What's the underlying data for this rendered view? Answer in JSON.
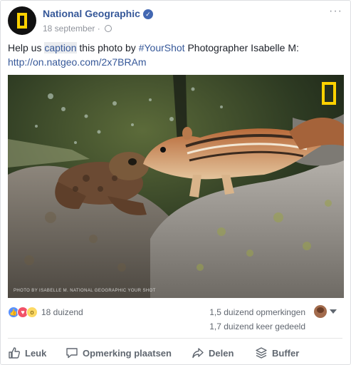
{
  "post": {
    "page_name": "National Geographic",
    "date": "18 september",
    "text_before": "Help us ",
    "text_caption": "caption",
    "text_mid": " this photo by ",
    "hashtag": "#YourShot",
    "text_after": " Photographer Isabelle M:",
    "link": "http://on.natgeo.com/2x7BRAm"
  },
  "photo": {
    "credit": "PHOTO BY ISABELLE M. NATIONAL GEOGRAPHIC YOUR SHOT"
  },
  "stats": {
    "reaction_count": "18 duizend",
    "comments": "1,5 duizend opmerkingen",
    "shares": "1,7 duizend keer gedeeld"
  },
  "actions": {
    "like": "Leuk",
    "comment": "Opmerking plaatsen",
    "share": "Delen",
    "buffer": "Buffer"
  },
  "colors": {
    "link": "#365899",
    "natgeo_yellow": "#ffd200",
    "like_blue": "#5890ff",
    "love_red": "#f25268"
  },
  "icons": [
    "more-icon",
    "verified-icon",
    "globe-icon",
    "like-icon",
    "comment-icon",
    "share-icon",
    "buffer-icon"
  ]
}
